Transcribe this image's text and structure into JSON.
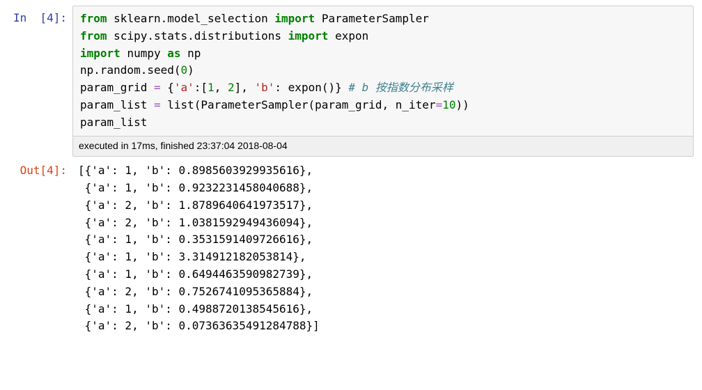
{
  "cell": {
    "in_label": "In  [4]:",
    "out_label": "Out[4]:",
    "execution": {
      "text": "executed in 17ms, finished 23:37:04 2018-08-04",
      "duration_ms": 17,
      "finished_at": "23:37:04 2018-08-04"
    },
    "code": {
      "l1": {
        "kw1": "from",
        "mod": "sklearn.model_selection",
        "kw2": "import",
        "name": "ParameterSampler"
      },
      "l2": {
        "kw1": "from",
        "mod": "scipy.stats.distributions",
        "kw2": "import",
        "name": "expon"
      },
      "l3": {
        "kw1": "import",
        "mod": "numpy",
        "kw2": "as",
        "alias": "np"
      },
      "l4": {
        "a": "np.random.seed(",
        "n": "0",
        "b": ")"
      },
      "l5": {
        "a": "param_grid ",
        "eq": "=",
        "b": " {",
        "s1": "'a'",
        "c": ":[",
        "n1": "1",
        "d": ", ",
        "n2": "2",
        "e": "], ",
        "s2": "'b'",
        "f": ": expon()} ",
        "cmt": "# b 按指数分布采样"
      },
      "l6": {
        "a": "param_list ",
        "eq": "=",
        "b": " list(ParameterSampler(param_grid, n_iter",
        "eq2": "=",
        "n": "10",
        "c": "))"
      },
      "l7": {
        "a": "param_list"
      }
    },
    "output_lines": {
      "r0": "[{'a': 1, 'b': 0.8985603929935616},",
      "r1": " {'a': 1, 'b': 0.9232231458040688},",
      "r2": " {'a': 2, 'b': 1.8789640641973517},",
      "r3": " {'a': 2, 'b': 1.0381592949436094},",
      "r4": " {'a': 1, 'b': 0.3531591409726616},",
      "r5": " {'a': 1, 'b': 3.314912182053814},",
      "r6": " {'a': 1, 'b': 0.6494463590982739},",
      "r7": " {'a': 2, 'b': 0.7526741095365884},",
      "r8": " {'a': 1, 'b': 0.4988720138545616},",
      "r9": " {'a': 2, 'b': 0.07363635491284788}]"
    },
    "output_data": [
      {
        "a": 1,
        "b": 0.8985603929935616
      },
      {
        "a": 1,
        "b": 0.9232231458040688
      },
      {
        "a": 2,
        "b": 1.8789640641973517
      },
      {
        "a": 2,
        "b": 1.0381592949436094
      },
      {
        "a": 1,
        "b": 0.3531591409726616
      },
      {
        "a": 1,
        "b": 3.314912182053814
      },
      {
        "a": 1,
        "b": 0.6494463590982739
      },
      {
        "a": 2,
        "b": 0.7526741095365884
      },
      {
        "a": 1,
        "b": 0.4988720138545616
      },
      {
        "a": 2,
        "b": 0.07363635491284788
      }
    ]
  }
}
